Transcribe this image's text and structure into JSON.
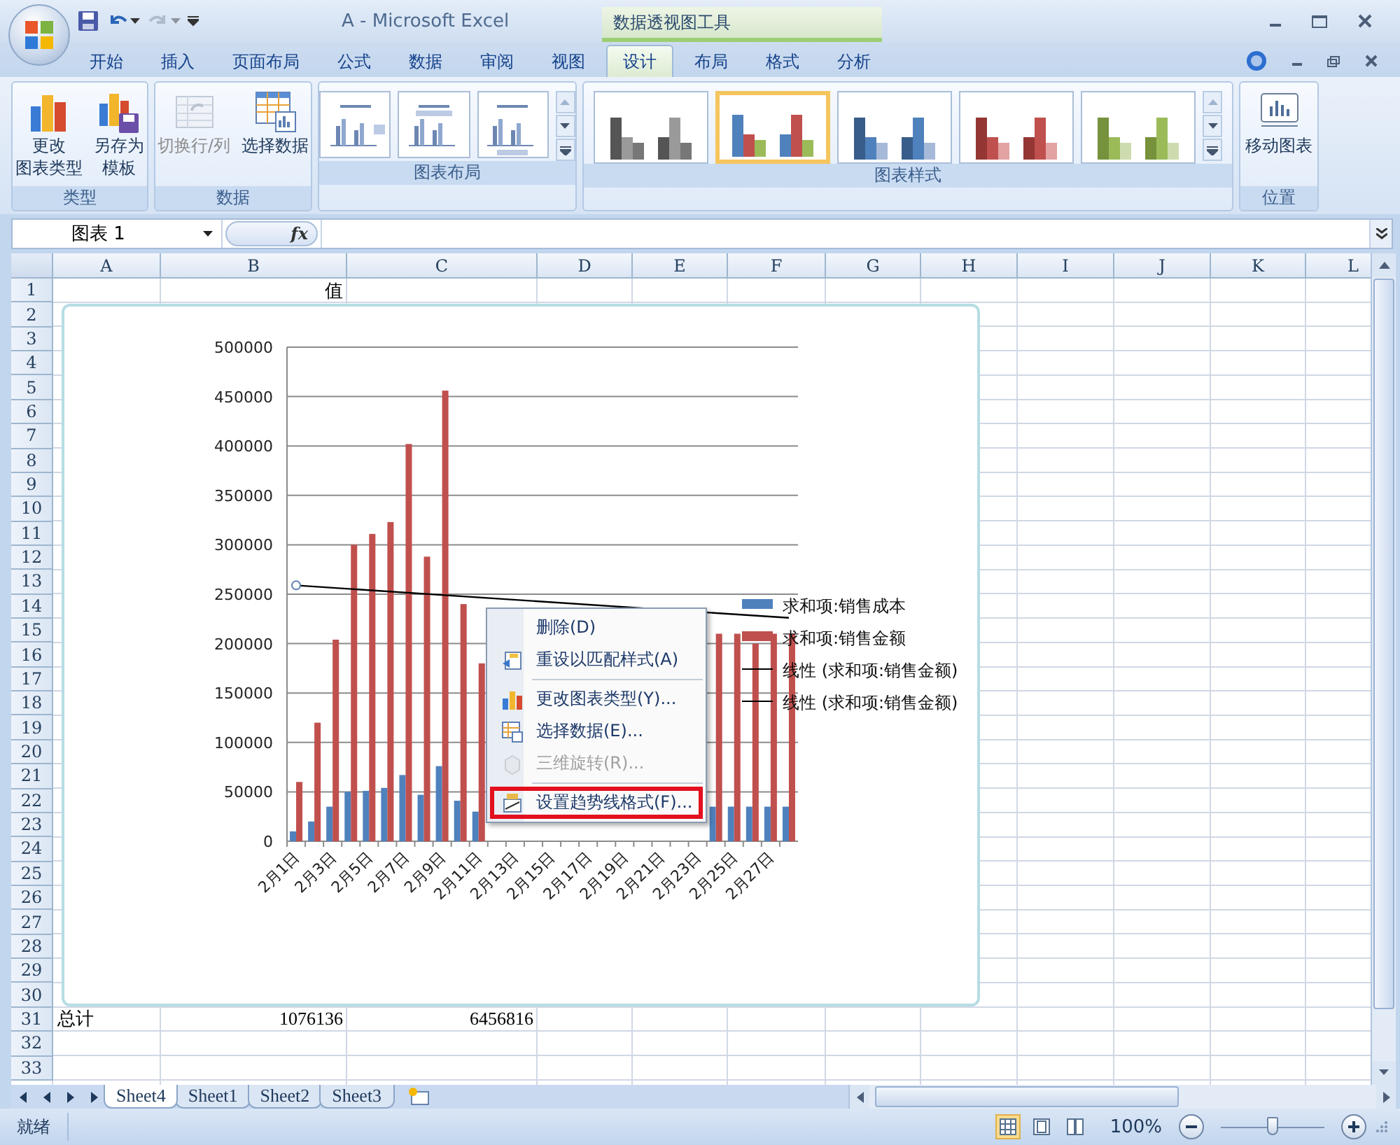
{
  "window": {
    "title": "A - Microsoft Excel",
    "context_group": "数据透视图工具"
  },
  "quick_access": [
    {
      "kind": "save",
      "disabled": false
    },
    {
      "kind": "undo",
      "disabled": false
    },
    {
      "kind": "redo",
      "disabled": true
    }
  ],
  "tabs": [
    {
      "label": "开始",
      "selected": false
    },
    {
      "label": "插入",
      "selected": false
    },
    {
      "label": "页面布局",
      "selected": false
    },
    {
      "label": "公式",
      "selected": false
    },
    {
      "label": "数据",
      "selected": false
    },
    {
      "label": "审阅",
      "selected": false
    },
    {
      "label": "视图",
      "selected": false
    },
    {
      "label": "设计",
      "selected": true
    },
    {
      "label": "布局",
      "selected": false
    },
    {
      "label": "格式",
      "selected": false
    },
    {
      "label": "分析",
      "selected": false
    }
  ],
  "ribbon": {
    "groups": [
      {
        "kind": "buttons",
        "label": "类型",
        "buttons": [
          {
            "kind": "chart-type",
            "lines": [
              "更改",
              "图表类型"
            ],
            "disabled": false
          },
          {
            "kind": "save-template",
            "lines": [
              "另存为",
              "模板"
            ],
            "disabled": false
          }
        ]
      },
      {
        "kind": "buttons",
        "label": "数据",
        "buttons": [
          {
            "kind": "switch",
            "lines": [
              "切换行/列"
            ],
            "disabled": true
          },
          {
            "kind": "select-data",
            "lines": [
              "选择数据"
            ],
            "disabled": false
          }
        ]
      },
      {
        "kind": "layouts",
        "label": "图表布局",
        "items": [
          {
            "selected": false
          },
          {
            "selected": false
          },
          {
            "selected": false
          }
        ]
      },
      {
        "kind": "styles",
        "label": "图表样式",
        "items": [
          {
            "selected": false,
            "bars": [
              {
                "color": "#555555"
              },
              {
                "color": "#9a9a9a"
              },
              {
                "color": "#777777"
              }
            ]
          },
          {
            "selected": true,
            "bars": [
              {
                "color": "#4f81bd"
              },
              {
                "color": "#c0504d"
              },
              {
                "color": "#9bbb59"
              }
            ]
          },
          {
            "selected": false,
            "bars": [
              {
                "color": "#385d8a"
              },
              {
                "color": "#4f81bd"
              },
              {
                "color": "#a7b9d9"
              }
            ]
          },
          {
            "selected": false,
            "bars": [
              {
                "color": "#943634"
              },
              {
                "color": "#c0504d"
              },
              {
                "color": "#e2a3a2"
              }
            ]
          },
          {
            "selected": false,
            "bars": [
              {
                "color": "#76923c"
              },
              {
                "color": "#9bbb59"
              },
              {
                "color": "#cddcae"
              }
            ]
          }
        ]
      },
      {
        "kind": "buttons",
        "label": "位置",
        "buttons": [
          {
            "kind": "move-chart",
            "lines": [
              "移动图表"
            ],
            "disabled": false
          }
        ]
      }
    ]
  },
  "formula_bar": {
    "name_box": "图表 1",
    "fx": "fx"
  },
  "sheet": {
    "columns": [
      "A",
      "B",
      "C",
      "D",
      "E",
      "F",
      "G",
      "H",
      "I",
      "J",
      "K",
      "L"
    ],
    "rows": [
      {
        "label": "1",
        "cells": [
          null,
          "值"
        ]
      },
      {
        "label": "2"
      },
      {
        "label": "3"
      },
      {
        "label": "4"
      },
      {
        "label": "5"
      },
      {
        "label": "6"
      },
      {
        "label": "7"
      },
      {
        "label": "8"
      },
      {
        "label": "9"
      },
      {
        "label": "10"
      },
      {
        "label": "11"
      },
      {
        "label": "12"
      },
      {
        "label": "13"
      },
      {
        "label": "14"
      },
      {
        "label": "15"
      },
      {
        "label": "16"
      },
      {
        "label": "17"
      },
      {
        "label": "18"
      },
      {
        "label": "19"
      },
      {
        "label": "20"
      },
      {
        "label": "21"
      },
      {
        "label": "22"
      },
      {
        "label": "23"
      },
      {
        "label": "24"
      },
      {
        "label": "25"
      },
      {
        "label": "26"
      },
      {
        "label": "27"
      },
      {
        "label": "28"
      },
      {
        "label": "29"
      },
      {
        "label": "30"
      },
      {
        "label": "31",
        "cells": [
          "总计",
          "1076136",
          "6456816"
        ]
      },
      {
        "label": "32"
      },
      {
        "label": "33"
      }
    ]
  },
  "chart": {
    "chart_data": {
      "type": "bar",
      "stacked": false,
      "grid": true,
      "legend": true,
      "categories": [
        "2月1日",
        null,
        "2月3日",
        null,
        "2月5日",
        null,
        "2月7日",
        null,
        "2月9日",
        null,
        "2月11日",
        null,
        "2月13日",
        null,
        "2月15日",
        null,
        "2月17日",
        null,
        "2月19日",
        null,
        "2月21日",
        null,
        "2月23日",
        null,
        "2月25日",
        null,
        "2月27日",
        null
      ],
      "ylim": [
        0,
        500000
      ],
      "yticks": [
        0,
        50000,
        100000,
        150000,
        200000,
        250000,
        300000,
        350000,
        400000,
        450000,
        500000
      ],
      "series": [
        {
          "name": "求和项:销售成本",
          "color": "#4f81bd",
          "values": [
            10000,
            20000,
            35000,
            50000,
            51000,
            54000,
            67000,
            47000,
            76000,
            41000,
            30000,
            null,
            null,
            null,
            null,
            null,
            null,
            null,
            null,
            null,
            null,
            null,
            null,
            35000,
            35000,
            35000,
            35000,
            35000
          ]
        },
        {
          "name": "求和项:销售金额",
          "color": "#c0504d",
          "values": [
            60000,
            120000,
            204000,
            300000,
            311000,
            323000,
            402000,
            288000,
            456000,
            240000,
            180000,
            null,
            null,
            null,
            null,
            null,
            null,
            null,
            null,
            null,
            null,
            null,
            null,
            210000,
            210000,
            200000,
            210000,
            210000
          ]
        }
      ]
    },
    "trendlines": [
      {
        "label": "线性 (求和项:销售金额)"
      },
      {
        "label": "线性 (求和项:销售金额)"
      }
    ]
  },
  "context_menu": {
    "items": [
      {
        "kind": "item",
        "label": "删除(D)",
        "disabled": false,
        "highlighted": false
      },
      {
        "kind": "item",
        "label": "重设以匹配样式(A)",
        "disabled": false,
        "highlighted": false
      },
      {
        "kind": "separator"
      },
      {
        "kind": "item",
        "label": "更改图表类型(Y)...",
        "disabled": false,
        "highlighted": false
      },
      {
        "kind": "item",
        "label": "选择数据(E)...",
        "disabled": false,
        "highlighted": false
      },
      {
        "kind": "item",
        "label": "三维旋转(R)...",
        "disabled": true,
        "highlighted": false
      },
      {
        "kind": "separator"
      },
      {
        "kind": "item",
        "label": "设置趋势线格式(F)...",
        "disabled": false,
        "highlighted": true
      }
    ]
  },
  "sheet_tabs": [
    {
      "label": "Sheet4",
      "selected": true
    },
    {
      "label": "Sheet1",
      "selected": false
    },
    {
      "label": "Sheet2",
      "selected": false
    },
    {
      "label": "Sheet3",
      "selected": false
    }
  ],
  "status_bar": {
    "text": "就绪",
    "views": [
      {
        "selected": true
      },
      {
        "selected": false
      },
      {
        "selected": false
      }
    ],
    "zoom": "100%",
    "zoom_slider": {
      "level": 0.5
    }
  }
}
